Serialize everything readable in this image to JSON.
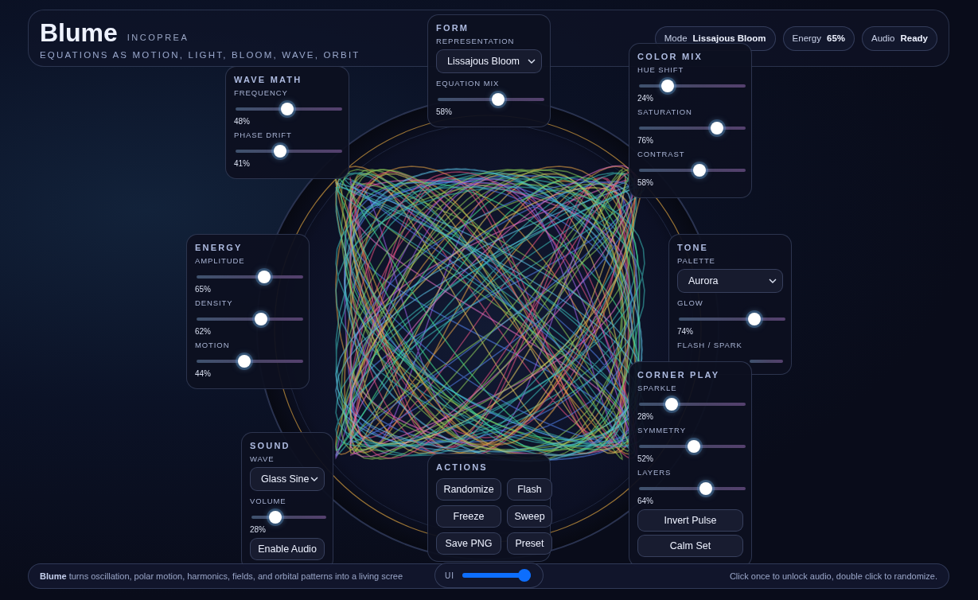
{
  "header": {
    "title": "Blume",
    "brand": "INCOPREA",
    "tagline": "EQUATIONS AS MOTION, LIGHT, BLOOM, WAVE, ORBIT"
  },
  "status_chips": [
    {
      "label": "Mode",
      "value": "Lissajous Bloom"
    },
    {
      "label": "Energy",
      "value": "65%"
    },
    {
      "label": "Audio",
      "value": "Ready"
    }
  ],
  "panels": [
    {
      "title": "WAVE MATH",
      "controls": [
        {
          "kind": "slider",
          "label": "FREQUENCY",
          "level": 0.48,
          "reading": "48%"
        },
        {
          "kind": "slider",
          "label": "PHASE DRIFT",
          "level": 0.41,
          "reading": "41%"
        }
      ]
    },
    {
      "title": "FORM",
      "controls": [
        {
          "kind": "select",
          "label": "REPRESENTATION",
          "value": "Lissajous Bloom"
        },
        {
          "kind": "slider",
          "label": "EQUATION MIX",
          "level": 0.58,
          "reading": "58%"
        }
      ]
    },
    {
      "title": "COLOR MIX",
      "controls": [
        {
          "kind": "slider",
          "label": "HUE SHIFT",
          "level": 0.24,
          "reading": "24%"
        },
        {
          "kind": "slider",
          "label": "SATURATION",
          "level": 0.76,
          "reading": "76%"
        },
        {
          "kind": "slider",
          "label": "CONTRAST",
          "level": 0.58,
          "reading": "58%"
        }
      ]
    },
    {
      "title": "ENERGY",
      "controls": [
        {
          "kind": "slider",
          "label": "AMPLITUDE",
          "level": 0.65,
          "reading": "65%"
        },
        {
          "kind": "slider",
          "label": "DENSITY",
          "level": 0.62,
          "reading": "62%"
        },
        {
          "kind": "slider",
          "label": "MOTION",
          "level": 0.44,
          "reading": "44%"
        }
      ]
    },
    {
      "title": "TONE",
      "controls": [
        {
          "kind": "select",
          "label": "PALETTE",
          "value": "Aurora"
        },
        {
          "kind": "slider",
          "label": "GLOW",
          "level": 0.74,
          "reading": "74%"
        },
        {
          "kind": "track",
          "label": "FLASH / SPARK"
        }
      ]
    },
    {
      "title": "SOUND",
      "controls": [
        {
          "kind": "select",
          "label": "WAVE",
          "value": "Glass Sine"
        },
        {
          "kind": "slider",
          "label": "VOLUME",
          "level": 0.28,
          "reading": "28%"
        },
        {
          "kind": "button",
          "label": "Enable Audio"
        }
      ]
    },
    {
      "title": "ACTIONS",
      "controls": [
        {
          "kind": "buttons",
          "items": [
            {
              "label": "Randomize"
            },
            {
              "label": "Flash"
            },
            {
              "label": "Freeze"
            },
            {
              "label": "Sweep"
            },
            {
              "label": "Save PNG"
            },
            {
              "label": "Preset"
            }
          ]
        }
      ]
    },
    {
      "title": "CORNER PLAY",
      "controls": [
        {
          "kind": "slider",
          "label": "SPARKLE",
          "level": 0.28,
          "reading": "28%"
        },
        {
          "kind": "slider",
          "label": "SYMMETRY",
          "level": 0.52,
          "reading": "52%"
        },
        {
          "kind": "slider",
          "label": "LAYERS",
          "level": 0.64,
          "reading": "64%"
        },
        {
          "kind": "button",
          "label": "Invert Pulse"
        },
        {
          "kind": "button",
          "label": "Calm Set"
        }
      ]
    }
  ],
  "footer": {
    "text": "**Blume** turns oscillation, polar motion, harmonics, fields, and orbital patterns into a living scree",
    "hint": "Click once to unlock audio, double click to randomize.",
    "ui_slider": {
      "label": "UI",
      "level": 1.0
    }
  }
}
